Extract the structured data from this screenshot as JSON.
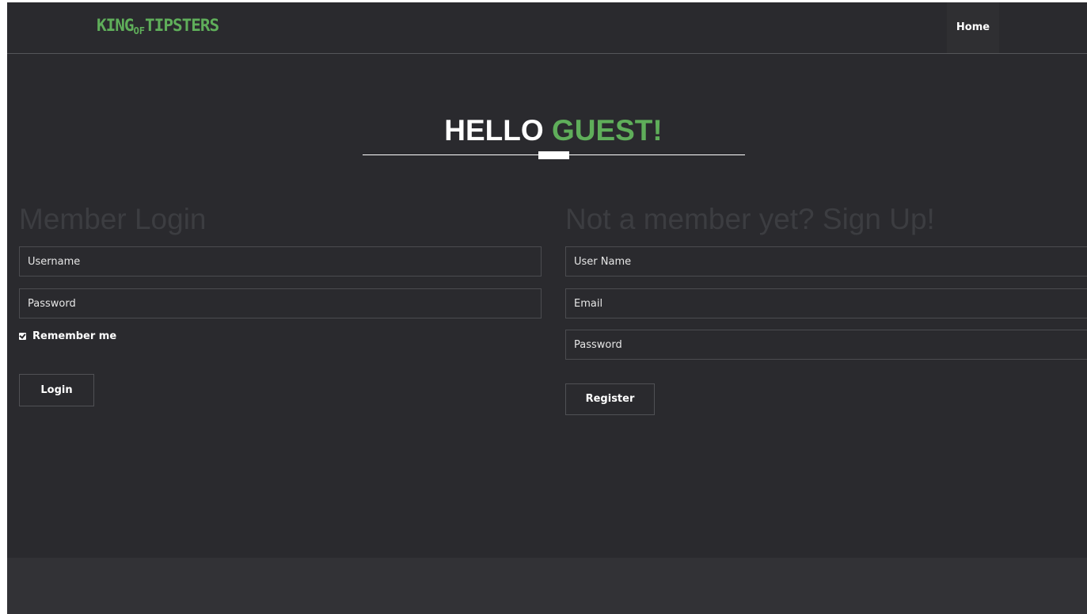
{
  "brand": {
    "logo_part1": "KING",
    "logo_part2": "OF",
    "logo_part3": "TIPSTERS",
    "color": "#5fae5a"
  },
  "nav": {
    "items": [
      {
        "label": "Home",
        "active": true
      }
    ]
  },
  "greeting": {
    "part1": "HELLO",
    "part2": "GUEST!"
  },
  "login": {
    "title": "Member Login",
    "username_placeholder": "Username",
    "password_placeholder": "Password",
    "remember_label": "Remember me",
    "remember_checked": true,
    "button_label": "Login"
  },
  "signup": {
    "title": "Not a member yet? Sign Up!",
    "username_placeholder": "User Name",
    "email_placeholder": "Email",
    "password_placeholder": "Password",
    "button_label": "Register"
  },
  "colors": {
    "background": "#2a2a2e",
    "accent": "#5fae5a",
    "footer": "#323236"
  }
}
